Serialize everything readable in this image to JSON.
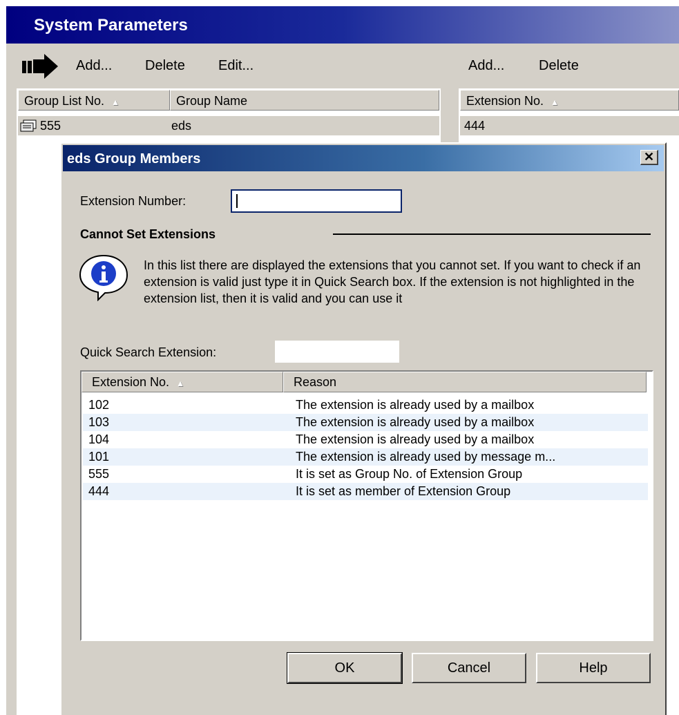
{
  "window": {
    "title": "System Parameters",
    "left_toolbar": {
      "add": "Add...",
      "delete": "Delete",
      "edit": "Edit..."
    },
    "right_toolbar": {
      "add": "Add...",
      "delete": "Delete"
    },
    "group_list": {
      "columns": [
        "Group List No.",
        "Group Name"
      ],
      "rows": [
        {
          "no": "555",
          "name": "eds"
        }
      ]
    },
    "extension_list": {
      "columns": [
        "Extension No."
      ],
      "rows": [
        {
          "no": "444"
        }
      ]
    }
  },
  "dialog": {
    "title": "eds Group Members",
    "extension_number_label": "Extension Number:",
    "extension_number_value": "",
    "section_title": "Cannot Set Extensions",
    "info_text": "In this list there are displayed the extensions that you cannot set. If you want to check if an extension is valid just type it in Quick Search box. If the extension is not highlighted in the extension list, then it is valid and you can use it",
    "quick_search_label": "Quick Search Extension:",
    "quick_search_value": "",
    "table": {
      "columns": [
        "Extension No.",
        "Reason"
      ],
      "rows": [
        {
          "ext": "102",
          "reason": "The extension is already used by a mailbox"
        },
        {
          "ext": "103",
          "reason": "The extension is already used by a mailbox"
        },
        {
          "ext": "104",
          "reason": "The extension is already used by a mailbox"
        },
        {
          "ext": "101",
          "reason": "The extension is already used by message m..."
        },
        {
          "ext": "555",
          "reason": "It is set as Group No. of Extension Group"
        },
        {
          "ext": "444",
          "reason": "It is set as member of Extension Group"
        }
      ]
    },
    "buttons": {
      "ok": "OK",
      "cancel": "Cancel",
      "help": "Help"
    }
  },
  "icons": {
    "toolbar": "arrow-right-icon",
    "group_row": "group-icon",
    "info": "info-icon",
    "close": "close-icon",
    "sort": "sort-ascending-icon"
  },
  "colors": {
    "title_gradient_start": "#000080",
    "dialog_title_start": "#0a246a",
    "face": "#d4d0c8",
    "alt_row": "#eaf2fb"
  }
}
